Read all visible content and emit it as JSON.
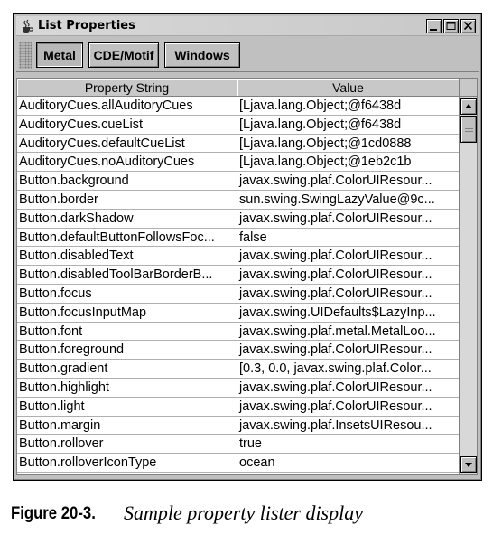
{
  "window": {
    "title": "List Properties",
    "minimize_glyph": "_",
    "maximize_glyph": "□",
    "close_glyph": "×"
  },
  "toolbar": {
    "buttons": [
      {
        "label": "Metal",
        "active": true
      },
      {
        "label": "CDE/Motif",
        "active": false
      },
      {
        "label": "Windows",
        "active": false
      }
    ]
  },
  "table": {
    "columns": [
      "Property String",
      "Value"
    ],
    "rows": [
      [
        "AuditoryCues.allAuditoryCues",
        "[Ljava.lang.Object;@f6438d"
      ],
      [
        "AuditoryCues.cueList",
        "[Ljava.lang.Object;@f6438d"
      ],
      [
        "AuditoryCues.defaultCueList",
        "[Ljava.lang.Object;@1cd0888"
      ],
      [
        "AuditoryCues.noAuditoryCues",
        "[Ljava.lang.Object;@1eb2c1b"
      ],
      [
        "Button.background",
        "javax.swing.plaf.ColorUIResour..."
      ],
      [
        "Button.border",
        "sun.swing.SwingLazyValue@9c..."
      ],
      [
        "Button.darkShadow",
        "javax.swing.plaf.ColorUIResour..."
      ],
      [
        "Button.defaultButtonFollowsFoc...",
        "false"
      ],
      [
        "Button.disabledText",
        "javax.swing.plaf.ColorUIResour..."
      ],
      [
        "Button.disabledToolBarBorderB...",
        "javax.swing.plaf.ColorUIResour..."
      ],
      [
        "Button.focus",
        "javax.swing.plaf.ColorUIResour..."
      ],
      [
        "Button.focusInputMap",
        "javax.swing.UIDefaults$LazyInp..."
      ],
      [
        "Button.font",
        "javax.swing.plaf.metal.MetalLoo..."
      ],
      [
        "Button.foreground",
        "javax.swing.plaf.ColorUIResour..."
      ],
      [
        "Button.gradient",
        "[0.3, 0.0, javax.swing.plaf.Color..."
      ],
      [
        "Button.highlight",
        "javax.swing.plaf.ColorUIResour..."
      ],
      [
        "Button.light",
        "javax.swing.plaf.ColorUIResour..."
      ],
      [
        "Button.margin",
        "javax.swing.plaf.InsetsUIResou..."
      ],
      [
        "Button.rollover",
        "true"
      ],
      [
        "Button.rolloverIconType",
        "ocean"
      ]
    ]
  },
  "caption": {
    "label": "Figure 20-3.",
    "text": "Sample property lister display"
  }
}
